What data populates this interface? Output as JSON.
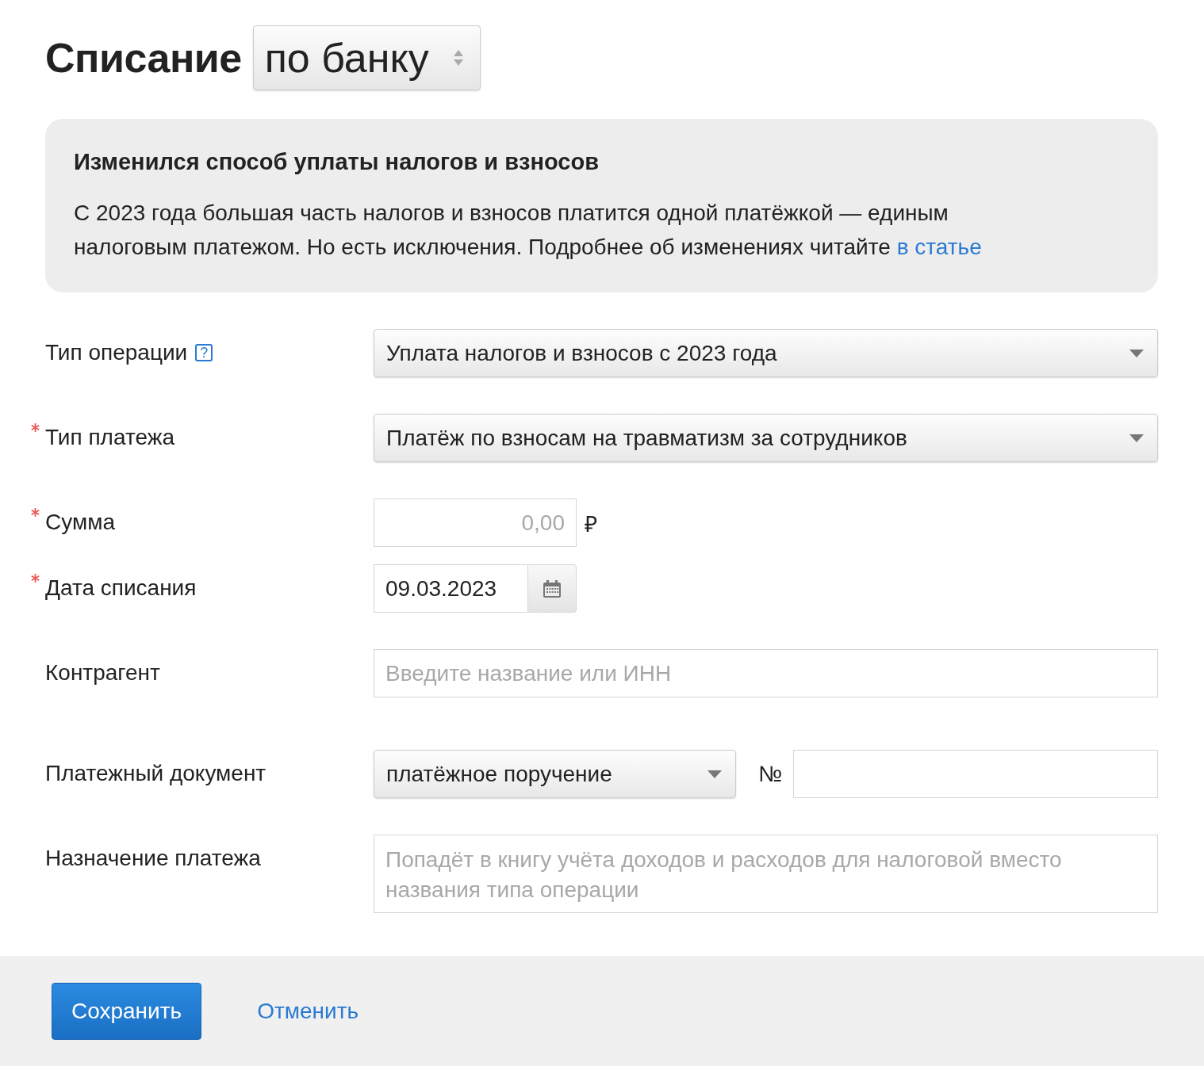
{
  "header": {
    "title": "Списание",
    "mode": "по банку"
  },
  "notice": {
    "title": "Изменился способ уплаты налогов и взносов",
    "text": "С 2023 года большая часть налогов и взносов платится одной платёжкой — единым налоговым платежом. Но есть исключения. Подробнее об изменениях читайте",
    "link": "в статье"
  },
  "fields": [
    {
      "kind": "select",
      "label": "Тип операции",
      "required": false,
      "help": "?",
      "value": "Уплата налогов и взносов с 2023 года"
    },
    {
      "kind": "select",
      "label": "Тип платежа",
      "required": true,
      "value": "Платёж по взносам на травматизм за сотрудников"
    },
    {
      "kind": "amount",
      "label": "Сумма",
      "required": true,
      "placeholder": "0,00",
      "currency": "₽"
    },
    {
      "kind": "date",
      "label": "Дата списания",
      "required": true,
      "value": "09.03.2023"
    },
    {
      "kind": "text",
      "label": "Контрагент",
      "required": false,
      "placeholder": "Введите название или ИНН"
    },
    {
      "kind": "document",
      "label": "Платежный документ",
      "required": false,
      "value": "платёжное поручение",
      "number_label": "№"
    },
    {
      "kind": "textarea",
      "label": "Назначение платежа",
      "required": false,
      "placeholder": "Попадёт в книгу учёта доходов и расходов для налоговой вместо названия типа операции"
    }
  ],
  "actions": {
    "save": "Сохранить",
    "cancel": "Отменить"
  }
}
